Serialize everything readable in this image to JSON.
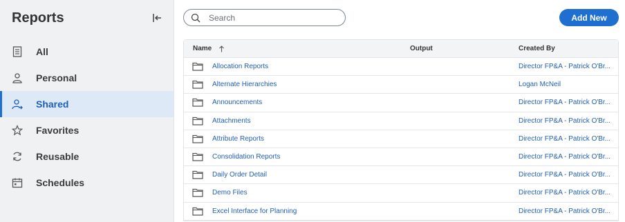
{
  "sidebar": {
    "title": "Reports",
    "items": [
      {
        "label": "All",
        "icon": "document-icon",
        "active": false
      },
      {
        "label": "Personal",
        "icon": "person-icon",
        "active": false
      },
      {
        "label": "Shared",
        "icon": "shared-person-icon",
        "active": true
      },
      {
        "label": "Favorites",
        "icon": "star-icon",
        "active": false
      },
      {
        "label": "Reusable",
        "icon": "refresh-icon",
        "active": false
      },
      {
        "label": "Schedules",
        "icon": "calendar-icon",
        "active": false
      }
    ]
  },
  "toolbar": {
    "search_placeholder": "Search",
    "add_label": "Add New"
  },
  "table": {
    "columns": {
      "name": "Name",
      "output": "Output",
      "created_by": "Created By"
    },
    "rows": [
      {
        "name": "Allocation Reports",
        "output": "",
        "created_by": "Director FP&A - Patrick O'Br..."
      },
      {
        "name": "Alternate Hierarchies",
        "output": "",
        "created_by": "Logan McNeil"
      },
      {
        "name": "Announcements",
        "output": "",
        "created_by": "Director FP&A - Patrick O'Br..."
      },
      {
        "name": "Attachments",
        "output": "",
        "created_by": "Director FP&A - Patrick O'Br..."
      },
      {
        "name": "Attribute Reports",
        "output": "",
        "created_by": "Director FP&A - Patrick O'Br..."
      },
      {
        "name": "Consolidation Reports",
        "output": "",
        "created_by": "Director FP&A - Patrick O'Br..."
      },
      {
        "name": "Daily Order Detail",
        "output": "",
        "created_by": "Director FP&A - Patrick O'Br..."
      },
      {
        "name": "Demo Files",
        "output": "",
        "created_by": "Director FP&A - Patrick O'Br..."
      },
      {
        "name": "Excel Interface for Planning",
        "output": "",
        "created_by": "Director FP&A - Patrick O'Br..."
      }
    ]
  },
  "colors": {
    "accent": "#1f6fd1",
    "link": "#1f5fb3",
    "sidebar_bg": "#f0f1f3",
    "active_bg": "#dde9f7"
  }
}
